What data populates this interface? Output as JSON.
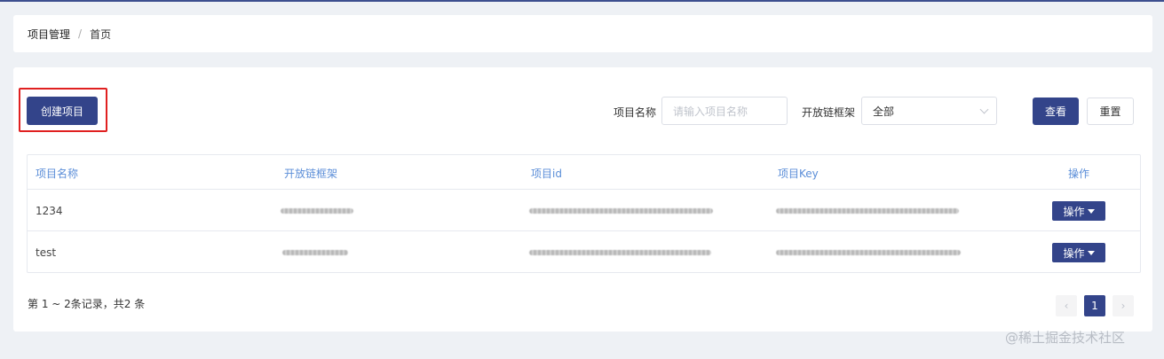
{
  "breadcrumb": {
    "items": [
      "项目管理",
      "首页"
    ],
    "separator": "/"
  },
  "toolbar": {
    "create_label": "创建项目",
    "name_label": "项目名称",
    "name_placeholder": "请输入项目名称",
    "framework_label": "开放链框架",
    "framework_selected": "全部",
    "query_label": "查看",
    "reset_label": "重置"
  },
  "table": {
    "headers": [
      "项目名称",
      "开放链框架",
      "项目id",
      "项目Key",
      "操作"
    ],
    "rows": [
      {
        "name": "1234",
        "op_label": "操作"
      },
      {
        "name": "test",
        "op_label": "操作"
      }
    ]
  },
  "footer": {
    "summary": "第 1 ~ 2条记录，共2 条",
    "current_page": "1",
    "prev_icon": "‹",
    "next_icon": "›"
  },
  "watermark": "@稀土掘金技术社区",
  "colors": {
    "primary": "#33448a",
    "header_text": "#5b8ed8",
    "highlight": "#e02020",
    "background": "#eef1f5"
  }
}
